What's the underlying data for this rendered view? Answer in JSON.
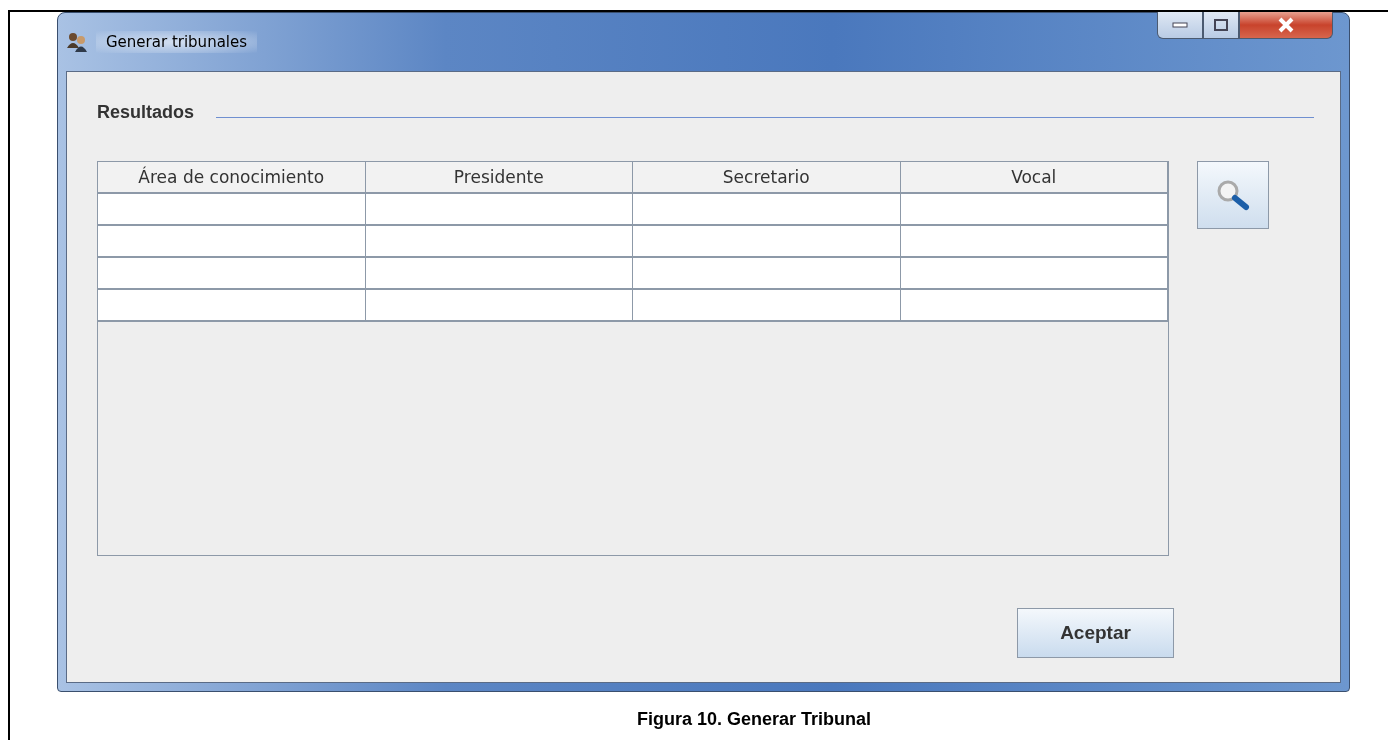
{
  "window": {
    "title": "Generar tribunales"
  },
  "section": {
    "title": "Resultados"
  },
  "table": {
    "columns": [
      "Área de conocimiento",
      "Presidente",
      "Secretario",
      "Vocal"
    ]
  },
  "buttons": {
    "accept": "Aceptar"
  },
  "caption": "Figura 10. Generar Tribunal"
}
